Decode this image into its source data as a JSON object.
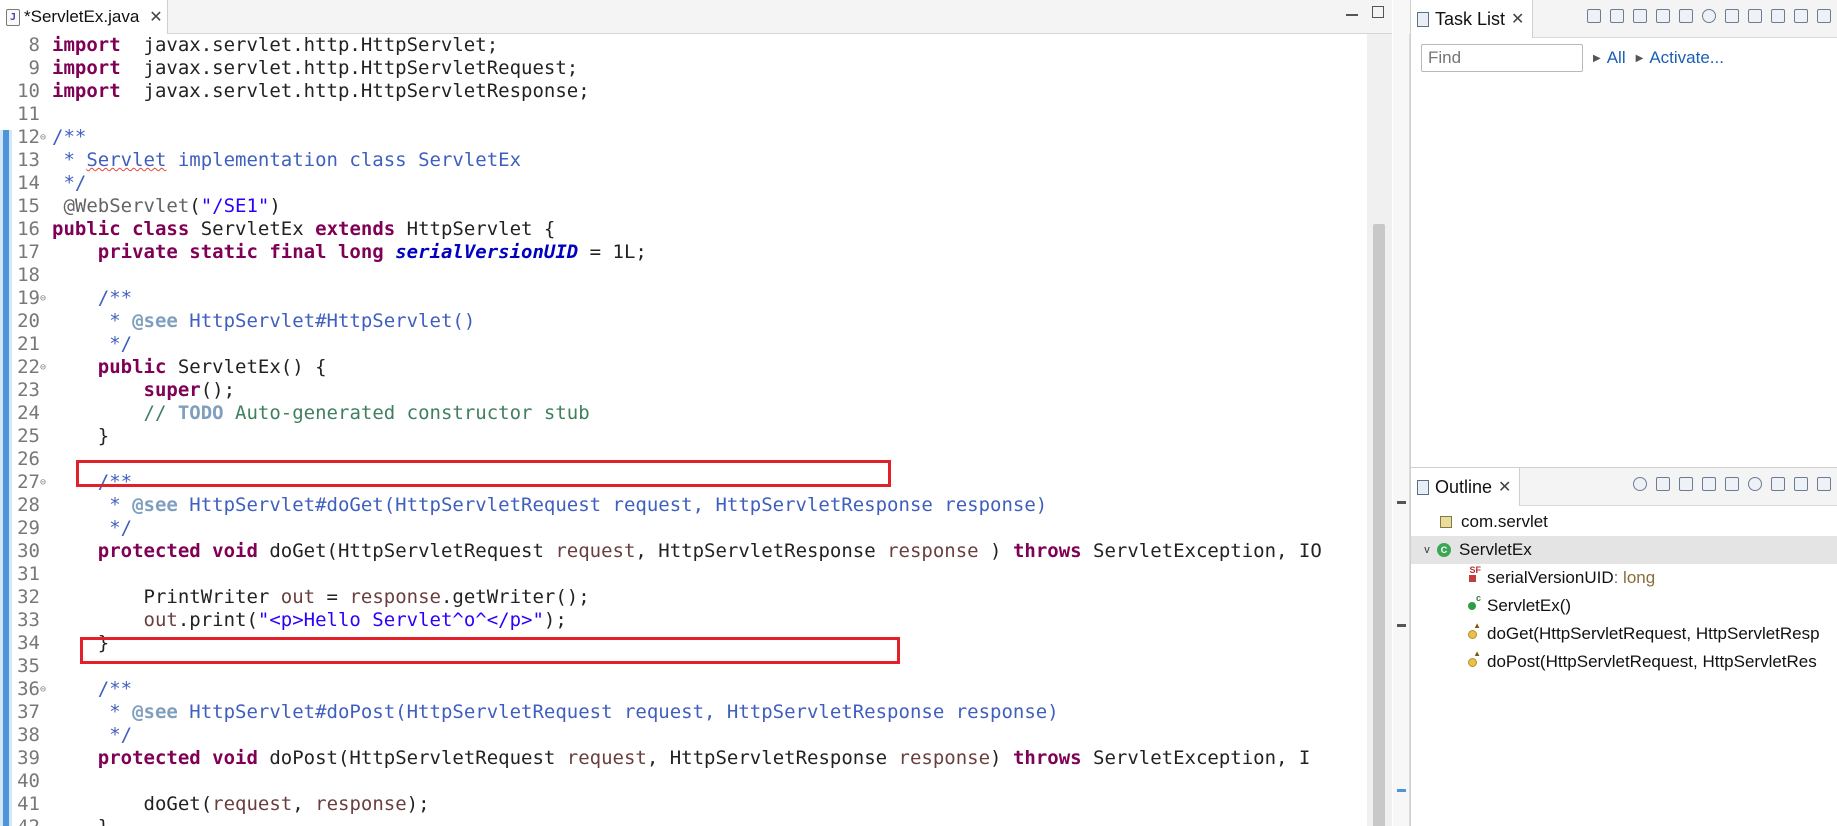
{
  "editor": {
    "tab_title": "*ServletEx.java",
    "lines": [
      {
        "n": "8",
        "fold": "",
        "parts": [
          [
            "kw",
            "import"
          ],
          [
            "",
            "  javax.servlet.http.HttpServlet;"
          ]
        ]
      },
      {
        "n": "9",
        "fold": "",
        "parts": [
          [
            "kw",
            "import"
          ],
          [
            "",
            "  javax.servlet.http.HttpServletRequest;"
          ]
        ]
      },
      {
        "n": "10",
        "fold": "",
        "parts": [
          [
            "kw",
            "import"
          ],
          [
            "",
            "  javax.servlet.http.HttpServletResponse;"
          ]
        ]
      },
      {
        "n": "11",
        "fold": "",
        "parts": []
      },
      {
        "n": "12",
        "fold": "⊖",
        "parts": [
          [
            "jd",
            "/**"
          ]
        ]
      },
      {
        "n": "13",
        "fold": "",
        "parts": [
          [
            "jd",
            " * "
          ],
          [
            "jd squig",
            "Servlet"
          ],
          [
            "jd",
            " implementation class ServletEx"
          ]
        ]
      },
      {
        "n": "14",
        "fold": "",
        "parts": [
          [
            "jd",
            " */"
          ]
        ]
      },
      {
        "n": "15",
        "fold": "",
        "parts": [
          [
            "ann",
            " @WebServlet"
          ],
          [
            "",
            "("
          ],
          [
            "str",
            "\"/SE1\""
          ],
          [
            "",
            ")"
          ]
        ]
      },
      {
        "n": "16",
        "fold": "",
        "parts": [
          [
            "kw",
            "public class"
          ],
          [
            "",
            " ServletEx "
          ],
          [
            "kw",
            "extends"
          ],
          [
            "",
            " HttpServlet {"
          ]
        ]
      },
      {
        "n": "17",
        "fold": "",
        "parts": [
          [
            "",
            "    "
          ],
          [
            "kw",
            "private static final long"
          ],
          [
            "",
            " "
          ],
          [
            "fld",
            "serialVersionUID"
          ],
          [
            "",
            " = 1L;"
          ]
        ]
      },
      {
        "n": "18",
        "fold": "",
        "parts": []
      },
      {
        "n": "19",
        "fold": "⊖",
        "parts": [
          [
            "jd",
            "    /**"
          ]
        ]
      },
      {
        "n": "20",
        "fold": "",
        "parts": [
          [
            "jd",
            "     * "
          ],
          [
            "jtag",
            "@see"
          ],
          [
            "jd",
            " HttpServlet#HttpServlet()"
          ]
        ]
      },
      {
        "n": "21",
        "fold": "",
        "parts": [
          [
            "jd",
            "     */"
          ]
        ]
      },
      {
        "n": "22",
        "fold": "⊖",
        "parts": [
          [
            "",
            "    "
          ],
          [
            "kw",
            "public"
          ],
          [
            "",
            " ServletEx() {"
          ]
        ]
      },
      {
        "n": "23",
        "fold": "",
        "parts": [
          [
            "",
            "        "
          ],
          [
            "kw",
            "super"
          ],
          [
            "",
            "();"
          ]
        ]
      },
      {
        "n": "24",
        "fold": "",
        "parts": [
          [
            "cm",
            "        // "
          ],
          [
            "todo",
            "TODO"
          ],
          [
            "cm",
            " Auto-generated constructor stub"
          ]
        ]
      },
      {
        "n": "25",
        "fold": "",
        "parts": [
          [
            "",
            "    }"
          ]
        ]
      },
      {
        "n": "26",
        "fold": "",
        "parts": []
      },
      {
        "n": "27",
        "fold": "⊖",
        "parts": [
          [
            "jd",
            "    /**"
          ]
        ]
      },
      {
        "n": "28",
        "fold": "",
        "parts": [
          [
            "jd",
            "     * "
          ],
          [
            "jtag",
            "@see"
          ],
          [
            "jd",
            " HttpServlet#doGet(HttpServletRequest request, HttpServletResponse response)"
          ]
        ]
      },
      {
        "n": "29",
        "fold": "",
        "parts": [
          [
            "jd",
            "     */"
          ]
        ]
      },
      {
        "n": "30",
        "fold": "",
        "parts": [
          [
            "",
            "    "
          ],
          [
            "kw",
            "protected void"
          ],
          [
            "",
            " doGet(HttpServletRequest "
          ],
          [
            "par",
            "request"
          ],
          [
            "",
            ", HttpServletResponse "
          ],
          [
            "par",
            "response"
          ],
          [
            "",
            " ) "
          ],
          [
            "kw",
            "throws"
          ],
          [
            "",
            " ServletException, IO"
          ]
        ]
      },
      {
        "n": "31",
        "fold": "",
        "parts": []
      },
      {
        "n": "32",
        "fold": "",
        "parts": [
          [
            "",
            "        PrintWriter "
          ],
          [
            "par",
            "out"
          ],
          [
            "",
            " = "
          ],
          [
            "par",
            "response"
          ],
          [
            "",
            ".getWriter();"
          ]
        ]
      },
      {
        "n": "33",
        "fold": "",
        "parts": [
          [
            "",
            "        "
          ],
          [
            "par",
            "out"
          ],
          [
            "",
            ".print("
          ],
          [
            "str",
            "\"<p>Hello Servlet^o^</p>\""
          ],
          [
            "",
            ");"
          ]
        ]
      },
      {
        "n": "34",
        "fold": "",
        "parts": [
          [
            "",
            "    }"
          ]
        ]
      },
      {
        "n": "35",
        "fold": "",
        "parts": []
      },
      {
        "n": "36",
        "fold": "⊖",
        "parts": [
          [
            "jd",
            "    /**"
          ]
        ]
      },
      {
        "n": "37",
        "fold": "",
        "parts": [
          [
            "jd",
            "     * "
          ],
          [
            "jtag",
            "@see"
          ],
          [
            "jd",
            " HttpServlet#doPost(HttpServletRequest request, HttpServletResponse response)"
          ]
        ]
      },
      {
        "n": "38",
        "fold": "",
        "parts": [
          [
            "jd",
            "     */"
          ]
        ]
      },
      {
        "n": "39",
        "fold": "",
        "parts": [
          [
            "",
            "    "
          ],
          [
            "kw",
            "protected void"
          ],
          [
            "",
            " doPost(HttpServletRequest "
          ],
          [
            "par",
            "request"
          ],
          [
            "",
            ", HttpServletResponse "
          ],
          [
            "par",
            "response"
          ],
          [
            "",
            ") "
          ],
          [
            "kw",
            "throws"
          ],
          [
            "",
            " ServletException, I"
          ]
        ]
      },
      {
        "n": "40",
        "fold": "",
        "parts": []
      },
      {
        "n": "41",
        "fold": "",
        "parts": [
          [
            "",
            "        doGet("
          ],
          [
            "par",
            "request"
          ],
          [
            "",
            ", "
          ],
          [
            "par",
            "response"
          ],
          [
            "",
            ");"
          ]
        ]
      },
      {
        "n": "42",
        "fold": "",
        "parts": [
          [
            "",
            "    }"
          ]
        ]
      }
    ]
  },
  "tasklist": {
    "tab_title": "Task List",
    "find_placeholder": "Find",
    "all_label": "All",
    "activate_label": "Activate..."
  },
  "outline": {
    "tab_title": "Outline",
    "items": [
      {
        "label": "com.servlet",
        "suffix": "",
        "icon": "package-icon"
      },
      {
        "label": "ServletEx",
        "suffix": "",
        "icon": "class-icon"
      },
      {
        "label": "serialVersionUID",
        "suffix": " : long",
        "icon": "field-icon"
      },
      {
        "label": "ServletEx()",
        "suffix": "",
        "icon": "constructor-icon"
      },
      {
        "label": "doGet(HttpServletRequest, HttpServletResp",
        "suffix": "",
        "icon": "method-icon"
      },
      {
        "label": "doPost(HttpServletRequest, HttpServletRes",
        "suffix": "",
        "icon": "method-icon"
      }
    ]
  },
  "colors": {
    "keyword": "#7f0055",
    "javadoc": "#3f5fbf",
    "string": "#2a00ff",
    "highlight_box": "#e1202a"
  }
}
